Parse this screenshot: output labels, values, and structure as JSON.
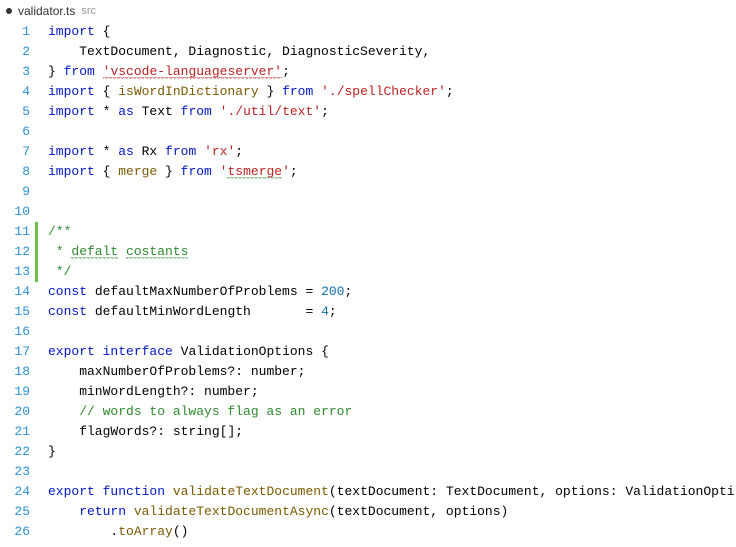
{
  "tab": {
    "dirty": true,
    "filename": "validator.ts",
    "path": "src"
  },
  "lines": [
    {
      "n": 1,
      "changed": false,
      "tokens": [
        [
          "kw",
          "import"
        ],
        [
          "",
          " {"
        ]
      ]
    },
    {
      "n": 2,
      "changed": false,
      "tokens": [
        [
          "",
          "    TextDocument, Diagnostic, DiagnosticSeverity,"
        ]
      ]
    },
    {
      "n": 3,
      "changed": false,
      "tokens": [
        [
          "",
          "} "
        ],
        [
          "kw",
          "from"
        ],
        [
          "",
          " "
        ],
        [
          "str squiggle-r",
          "'vscode-languageserver'"
        ],
        [
          "",
          ";"
        ]
      ]
    },
    {
      "n": 4,
      "changed": false,
      "tokens": [
        [
          "kw",
          "import"
        ],
        [
          "",
          " { "
        ],
        [
          "fn",
          "isWordInDictionary"
        ],
        [
          "",
          " } "
        ],
        [
          "kw",
          "from"
        ],
        [
          "",
          " "
        ],
        [
          "str",
          "'./spellChecker'"
        ],
        [
          "",
          ";"
        ]
      ]
    },
    {
      "n": 5,
      "changed": false,
      "tokens": [
        [
          "kw",
          "import"
        ],
        [
          "",
          " * "
        ],
        [
          "kw",
          "as"
        ],
        [
          "",
          " Text "
        ],
        [
          "kw",
          "from"
        ],
        [
          "",
          " "
        ],
        [
          "str",
          "'./util/text'"
        ],
        [
          "",
          ";"
        ]
      ]
    },
    {
      "n": 6,
      "changed": false,
      "tokens": []
    },
    {
      "n": 7,
      "changed": false,
      "tokens": [
        [
          "kw",
          "import"
        ],
        [
          "",
          " * "
        ],
        [
          "kw",
          "as"
        ],
        [
          "",
          " Rx "
        ],
        [
          "kw",
          "from"
        ],
        [
          "",
          " "
        ],
        [
          "str",
          "'rx'"
        ],
        [
          "",
          ";"
        ]
      ]
    },
    {
      "n": 8,
      "changed": false,
      "tokens": [
        [
          "kw",
          "import"
        ],
        [
          "",
          " { "
        ],
        [
          "fn",
          "merge"
        ],
        [
          "",
          " } "
        ],
        [
          "kw",
          "from"
        ],
        [
          "",
          " "
        ],
        [
          "str",
          "'"
        ],
        [
          "str squiggle-g",
          "tsmerge"
        ],
        [
          "str",
          "'"
        ],
        [
          "",
          ";"
        ]
      ]
    },
    {
      "n": 9,
      "changed": false,
      "tokens": []
    },
    {
      "n": 10,
      "changed": false,
      "tokens": []
    },
    {
      "n": 11,
      "changed": true,
      "tokens": [
        [
          "cmt",
          "/**"
        ]
      ]
    },
    {
      "n": 12,
      "changed": true,
      "tokens": [
        [
          "cmt",
          " * "
        ],
        [
          "cmt squiggle-g",
          "defalt"
        ],
        [
          "cmt",
          " "
        ],
        [
          "cmt squiggle-g",
          "costants"
        ]
      ]
    },
    {
      "n": 13,
      "changed": true,
      "tokens": [
        [
          "cmt",
          " */"
        ]
      ]
    },
    {
      "n": 14,
      "changed": false,
      "tokens": [
        [
          "kw",
          "const"
        ],
        [
          "",
          " defaultMaxNumberOfProblems = "
        ],
        [
          "num",
          "200"
        ],
        [
          "",
          ";"
        ]
      ]
    },
    {
      "n": 15,
      "changed": false,
      "tokens": [
        [
          "kw",
          "const"
        ],
        [
          "",
          " defaultMinWordLength       = "
        ],
        [
          "num",
          "4"
        ],
        [
          "",
          ";"
        ]
      ]
    },
    {
      "n": 16,
      "changed": false,
      "tokens": []
    },
    {
      "n": 17,
      "changed": false,
      "tokens": [
        [
          "kw",
          "export"
        ],
        [
          "",
          " "
        ],
        [
          "kw",
          "interface"
        ],
        [
          "",
          " "
        ],
        [
          "type",
          "ValidationOptions"
        ],
        [
          "",
          " {"
        ]
      ]
    },
    {
      "n": 18,
      "changed": false,
      "tokens": [
        [
          "",
          "    maxNumberOfProblems?: "
        ],
        [
          "type",
          "number"
        ],
        [
          "",
          ";"
        ]
      ]
    },
    {
      "n": 19,
      "changed": false,
      "tokens": [
        [
          "",
          "    minWordLength?: "
        ],
        [
          "type",
          "number"
        ],
        [
          "",
          ";"
        ]
      ]
    },
    {
      "n": 20,
      "changed": false,
      "tokens": [
        [
          "cmt",
          "    // words to always flag as an error"
        ]
      ]
    },
    {
      "n": 21,
      "changed": false,
      "tokens": [
        [
          "",
          "    flagWords?: "
        ],
        [
          "type",
          "string"
        ],
        [
          "",
          "[];"
        ]
      ]
    },
    {
      "n": 22,
      "changed": false,
      "tokens": [
        [
          "",
          "}"
        ]
      ]
    },
    {
      "n": 23,
      "changed": false,
      "tokens": []
    },
    {
      "n": 24,
      "changed": false,
      "tokens": [
        [
          "kw",
          "export"
        ],
        [
          "",
          " "
        ],
        [
          "kw",
          "function"
        ],
        [
          "",
          " "
        ],
        [
          "fn",
          "validateTextDocument"
        ],
        [
          "",
          "(textDocument: TextDocument, options: ValidationOpti"
        ]
      ]
    },
    {
      "n": 25,
      "changed": false,
      "tokens": [
        [
          "",
          "    "
        ],
        [
          "kw",
          "return"
        ],
        [
          "",
          " "
        ],
        [
          "fn",
          "validateTextDocumentAsync"
        ],
        [
          "",
          "(textDocument, options)"
        ]
      ]
    },
    {
      "n": 26,
      "changed": false,
      "tokens": [
        [
          "",
          "        ."
        ],
        [
          "fn",
          "toArray"
        ],
        [
          "",
          "()"
        ]
      ]
    }
  ]
}
